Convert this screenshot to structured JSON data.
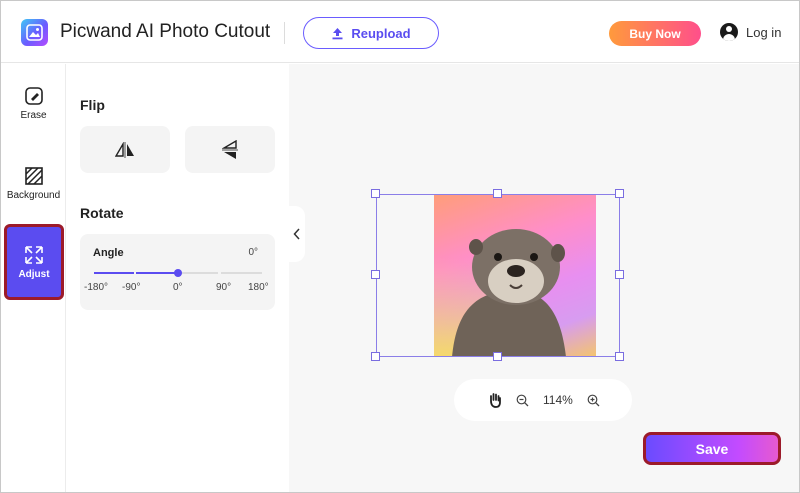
{
  "app": {
    "title": "Picwand AI Photo Cutout"
  },
  "header": {
    "reupload_label": "Reupload",
    "buy_now_label": "Buy Now",
    "login_label": "Log in"
  },
  "toolbar": {
    "items": [
      {
        "label": "Erase",
        "icon": "eraser-icon"
      },
      {
        "label": "Background",
        "icon": "background-pattern-icon"
      },
      {
        "label": "Adjust",
        "icon": "expand-arrows-icon",
        "active": true
      }
    ]
  },
  "panel": {
    "flip_title": "Flip",
    "rotate_title": "Rotate",
    "angle_label": "Angle",
    "angle_value": "0°",
    "angle_ticks": [
      "-180°",
      "-90°",
      "0°",
      "90°",
      "180°"
    ]
  },
  "canvas": {
    "zoom_level": "114%"
  },
  "footer": {
    "save_label": "Save"
  },
  "colors": {
    "accent": "#5b4cf0",
    "highlight_border": "#9c1b2a",
    "buy_now_gradient_start": "#ff9a3c",
    "buy_now_gradient_end": "#ff4f8b"
  }
}
